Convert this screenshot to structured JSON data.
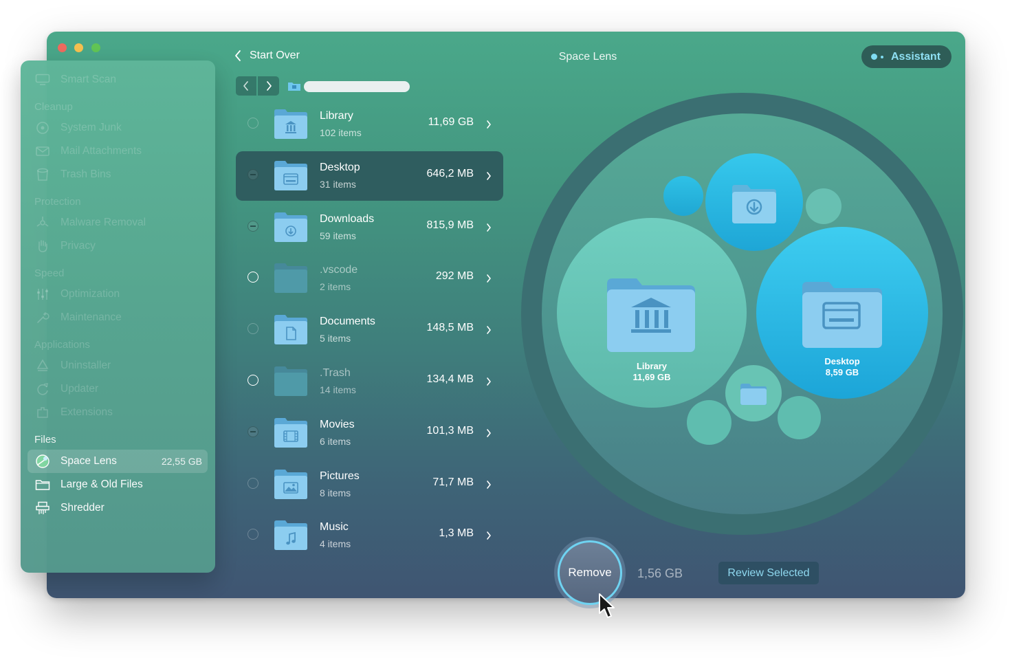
{
  "window": {
    "title": "Space Lens"
  },
  "header": {
    "back_label": "Start Over",
    "assistant_label": "Assistant"
  },
  "sidebar": {
    "items_top": [
      {
        "label": "Smart Scan",
        "icon": "monitor-icon"
      }
    ],
    "sections": [
      {
        "heading": "Cleanup",
        "items": [
          {
            "label": "System Junk",
            "icon": "disk-icon"
          },
          {
            "label": "Mail Attachments",
            "icon": "mail-icon"
          },
          {
            "label": "Trash Bins",
            "icon": "trash-icon"
          }
        ]
      },
      {
        "heading": "Protection",
        "items": [
          {
            "label": "Malware Removal",
            "icon": "biohazard-icon"
          },
          {
            "label": "Privacy",
            "icon": "hand-icon"
          }
        ]
      },
      {
        "heading": "Speed",
        "items": [
          {
            "label": "Optimization",
            "icon": "sliders-icon"
          },
          {
            "label": "Maintenance",
            "icon": "wrench-icon"
          }
        ]
      },
      {
        "heading": "Applications",
        "items": [
          {
            "label": "Uninstaller",
            "icon": "uninstaller-icon"
          },
          {
            "label": "Updater",
            "icon": "updater-icon"
          },
          {
            "label": "Extensions",
            "icon": "extensions-icon"
          }
        ]
      },
      {
        "heading": "Files",
        "items": [
          {
            "label": "Space Lens",
            "value": "22,55 GB",
            "icon": "space-lens-icon",
            "active": true
          },
          {
            "label": "Large & Old Files",
            "icon": "folder-icon"
          },
          {
            "label": "Shredder",
            "icon": "shredder-icon"
          }
        ]
      }
    ]
  },
  "file_list": [
    {
      "name": "Library",
      "count": "102 items",
      "size": "11,69 GB",
      "state": "empty",
      "icon": "library-folder-icon"
    },
    {
      "name": "Desktop",
      "count": "31 items",
      "size": "646,2 MB",
      "state": "partial",
      "selected": true,
      "icon": "desktop-folder-icon"
    },
    {
      "name": "Downloads",
      "count": "59 items",
      "size": "815,9 MB",
      "state": "partial",
      "icon": "downloads-folder-icon"
    },
    {
      "name": ".vscode",
      "count": "2 items",
      "size": "292 MB",
      "state": "empty-bright",
      "icon": "plain-folder-icon"
    },
    {
      "name": "Documents",
      "count": "5 items",
      "size": "148,5 MB",
      "state": "empty",
      "icon": "documents-folder-icon"
    },
    {
      "name": ".Trash",
      "count": "14 items",
      "size": "134,4 MB",
      "state": "empty-bright",
      "icon": "plain-folder-icon"
    },
    {
      "name": "Movies",
      "count": "6 items",
      "size": "101,3 MB",
      "state": "partial",
      "icon": "movies-folder-icon"
    },
    {
      "name": "Pictures",
      "count": "8 items",
      "size": "71,7 MB",
      "state": "empty",
      "icon": "pictures-folder-icon"
    },
    {
      "name": "Music",
      "count": "4 items",
      "size": "1,3 MB",
      "state": "empty",
      "icon": "music-folder-icon"
    }
  ],
  "lens": {
    "library": {
      "name": "Library",
      "size": "11,69 GB"
    },
    "desktop": {
      "name": "Desktop",
      "size": "8,59 GB"
    }
  },
  "footer": {
    "remove_label": "Remove",
    "selected_size": "1,56 GB",
    "review_label": "Review Selected"
  },
  "colors": {
    "accent_blue": "#2fc0e4",
    "selected_row": "#2f5d5f",
    "assistant_bg": "#2e5d57",
    "review_text": "#8fd8ef"
  }
}
